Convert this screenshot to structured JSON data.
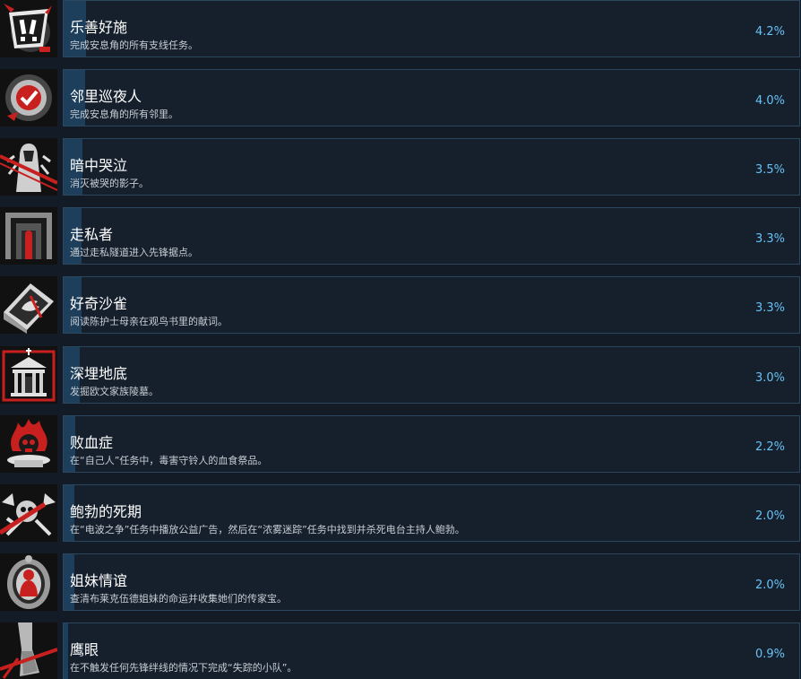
{
  "achievements": [
    {
      "title": "乐善好施",
      "description": "完成安息角的所有支线任务。",
      "percent_label": "4.2%",
      "percent": 4.2,
      "icon": "exclamation-badge-icon"
    },
    {
      "title": "邻里巡夜人",
      "description": "完成安息角的所有邻里。",
      "percent_label": "4.0%",
      "percent": 4.0,
      "icon": "check-seal-icon"
    },
    {
      "title": "暗中哭泣",
      "description": "消灭被哭的影子。",
      "percent_label": "3.5%",
      "percent": 3.5,
      "icon": "weeping-figure-icon"
    },
    {
      "title": "走私者",
      "description": "通过走私隧道进入先锋据点。",
      "percent_label": "3.3%",
      "percent": 3.3,
      "icon": "tunnel-door-icon"
    },
    {
      "title": "好奇沙雀",
      "description": "阅读陈护士母亲在观鸟书里的献词。",
      "percent_label": "3.3%",
      "percent": 3.3,
      "icon": "bird-book-icon"
    },
    {
      "title": "深埋地底",
      "description": "发掘欧文家族陵墓。",
      "percent_label": "3.0%",
      "percent": 3.0,
      "icon": "mausoleum-icon"
    },
    {
      "title": "败血症",
      "description": "在“自己人”任务中，毒害守铃人的血食祭品。",
      "percent_label": "2.2%",
      "percent": 2.2,
      "icon": "flaming-skull-icon"
    },
    {
      "title": "鲍勃的死期",
      "description": "在“电波之争”任务中播放公益广告，然后在“浓雾迷踪”任务中找到并杀死电台主持人鲍勃。",
      "percent_label": "2.0%",
      "percent": 2.0,
      "icon": "radio-skull-icon"
    },
    {
      "title": "姐妹情谊",
      "description": "查清布莱克伍德姐妹的命运并收集她们的传家宝。",
      "percent_label": "2.0%",
      "percent": 2.0,
      "icon": "cameo-medallion-icon"
    },
    {
      "title": "鹰眼",
      "description": "在不触发任何先锋绊线的情况下完成“失踪的小队”。",
      "percent_label": "0.9%",
      "percent": 0.9,
      "icon": "tripwire-leg-icon"
    }
  ],
  "colors": {
    "background": "#131c26",
    "panel": "#16202d",
    "panel_border": "#2a475e",
    "progress_fill": "#1e3f5c",
    "percent_text": "#67c1f5",
    "accent_red": "#c8201e"
  }
}
